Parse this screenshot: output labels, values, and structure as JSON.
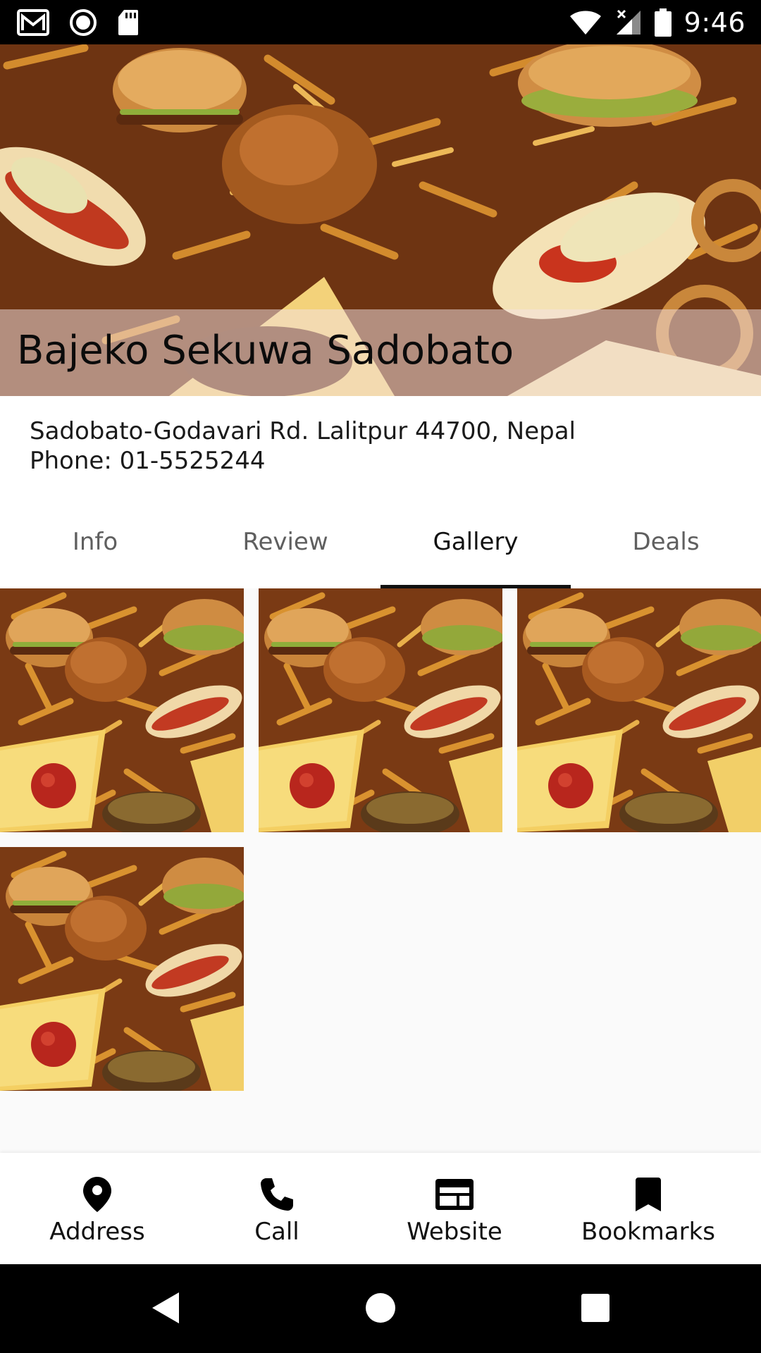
{
  "status_bar": {
    "time": "9:46",
    "left_icons": [
      "gmail-icon",
      "record-icon",
      "sd-card-icon"
    ],
    "right_icons": [
      "wifi-icon",
      "cell-signal-icon",
      "battery-icon"
    ]
  },
  "restaurant": {
    "name": "Bajeko Sekuwa Sadobato",
    "address": "Sadobato-Godavari Rd. Lalitpur 44700, Nepal",
    "phone": "Phone: 01-5525244"
  },
  "tabs": [
    {
      "label": "Info",
      "active": false
    },
    {
      "label": "Review",
      "active": false
    },
    {
      "label": "Gallery",
      "active": true
    },
    {
      "label": "Deals",
      "active": false
    }
  ],
  "gallery": {
    "image_count": 4
  },
  "bottom_nav": [
    {
      "label": "Address",
      "icon": "location-pin-icon"
    },
    {
      "label": "Call",
      "icon": "phone-icon"
    },
    {
      "label": "Website",
      "icon": "web-icon"
    },
    {
      "label": "Bookmarks",
      "icon": "bookmark-icon"
    }
  ],
  "system_nav": [
    "back-icon",
    "home-icon",
    "recents-icon"
  ],
  "colors": {
    "status_bar": "#000000",
    "title_band": "#f4e2e2",
    "active_tab": "#111111",
    "inactive_tab": "#5f5f5f",
    "background": "#fafafa"
  }
}
